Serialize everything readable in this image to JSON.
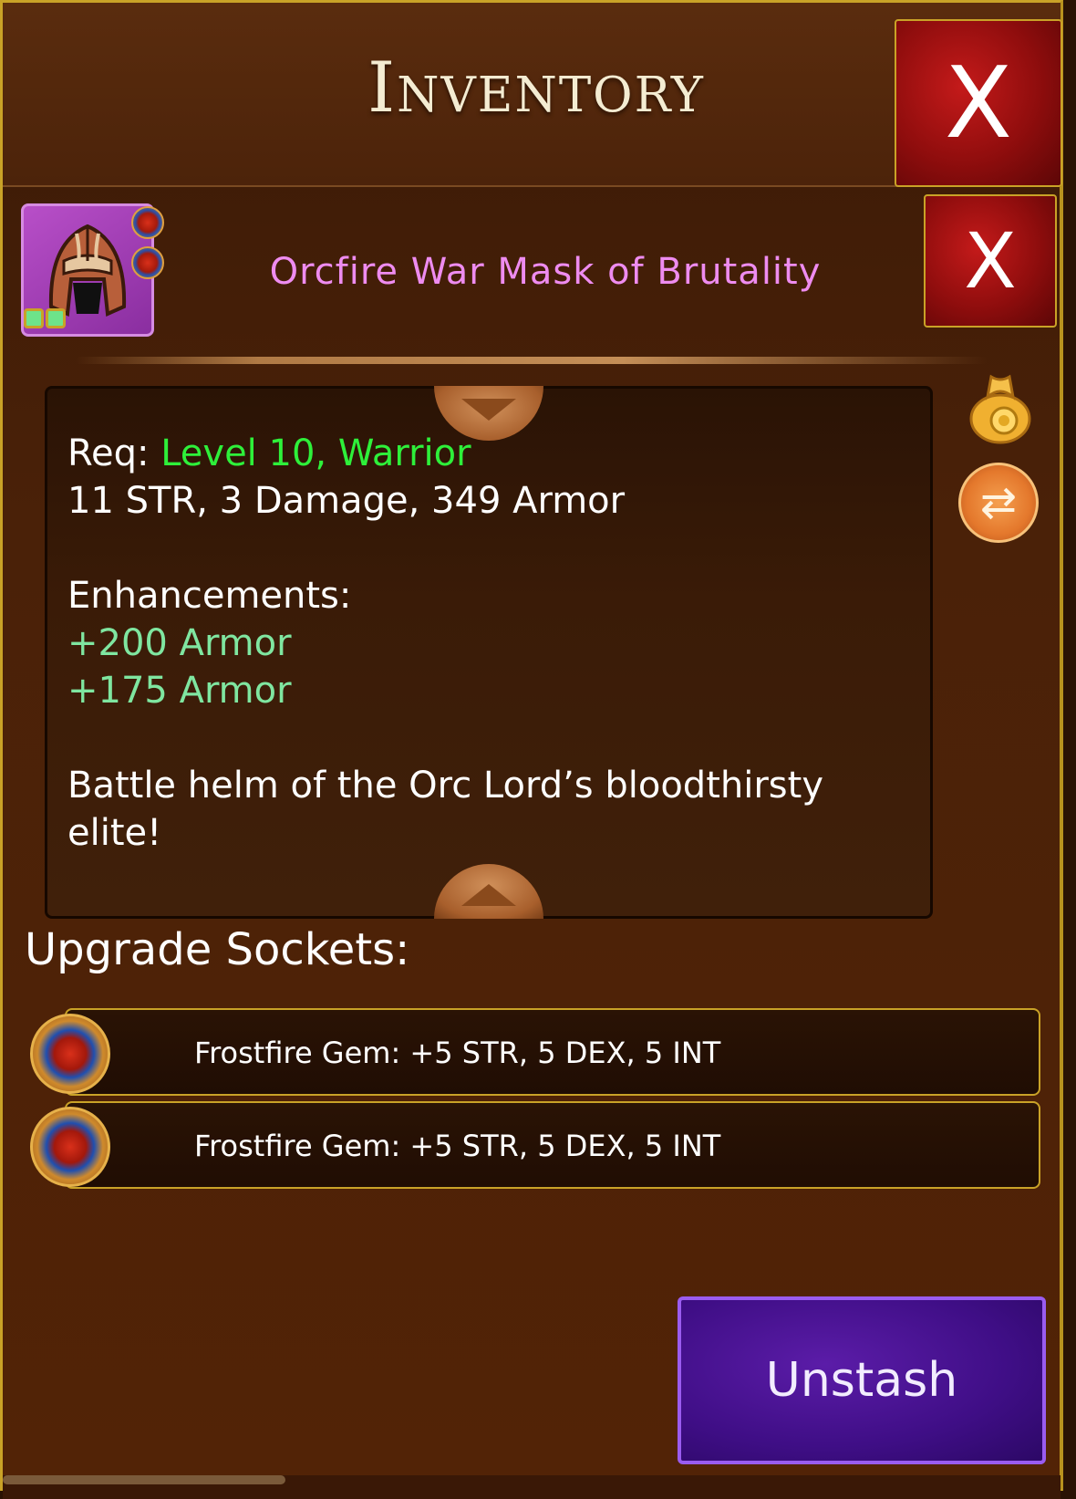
{
  "window": {
    "title": "Inventory",
    "close_label": "X"
  },
  "item": {
    "name": "Orcfire War Mask of Brutality",
    "close_label": "X",
    "icon": "orc-war-helm-icon",
    "name_color": "#ee8cf0"
  },
  "details": {
    "req_label": "Req:",
    "req_value": "Level 10, Warrior",
    "stats": "11 STR, 3 Damage, 349 Armor",
    "enhancements_label": "Enhancements:",
    "enhancements": [
      "+200 Armor",
      "+175 Armor"
    ],
    "description": "Battle helm of the Orc Lord’s bloodthirsty",
    "description_cont": "elite!"
  },
  "side_icons": [
    "coin-bag-icon",
    "swap-icon"
  ],
  "sockets": {
    "title": "Upgrade Sockets:",
    "items": [
      {
        "text": "Frostfire Gem: +5 STR, 5 DEX, 5 INT",
        "icon": "frostfire-gem-icon"
      },
      {
        "text": "Frostfire Gem: +5 STR, 5 DEX, 5 INT",
        "icon": "frostfire-gem-icon"
      }
    ]
  },
  "actions": {
    "unstash_label": "Unstash"
  },
  "colors": {
    "requirement": "#2ef03a",
    "enhancement": "#7fe6a0",
    "border_gold": "#c9a227",
    "unstash_purple": "#3f0e86",
    "close_red": "#8f0d0d"
  }
}
